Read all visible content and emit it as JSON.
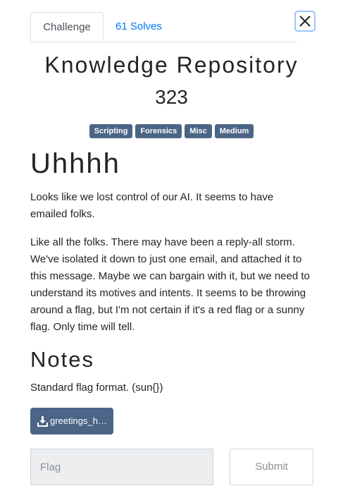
{
  "tabs": {
    "challenge": "Challenge",
    "solves": "61 Solves"
  },
  "challenge": {
    "name": "Knowledge Repository",
    "points": "323",
    "tags": [
      "Scripting",
      "Forensics",
      "Misc",
      "Medium"
    ]
  },
  "description": {
    "heading": "Uhhhh",
    "paragraphs": [
      "Looks like we lost control of our AI. It seems to have emailed folks.",
      "Like all the folks. There may have been a reply-all storm. We've isolated it down to just one email, and attached it to this message. Maybe we can bargain with it, but we need to understand its motives and intents. It seems to be throwing around a flag, but I'm not certain if it's a red flag or a sunny flag. Only time will tell."
    ]
  },
  "notes": {
    "heading": "Notes",
    "text": "Standard flag format. (sun{})"
  },
  "file": {
    "label": "greetings_human.zip"
  },
  "form": {
    "placeholder": "Flag",
    "submit": "Submit"
  },
  "icons": {
    "close": "close-icon",
    "download": "download-icon"
  },
  "colors": {
    "tag_bg": "#4b6587",
    "link": "#007bff"
  }
}
